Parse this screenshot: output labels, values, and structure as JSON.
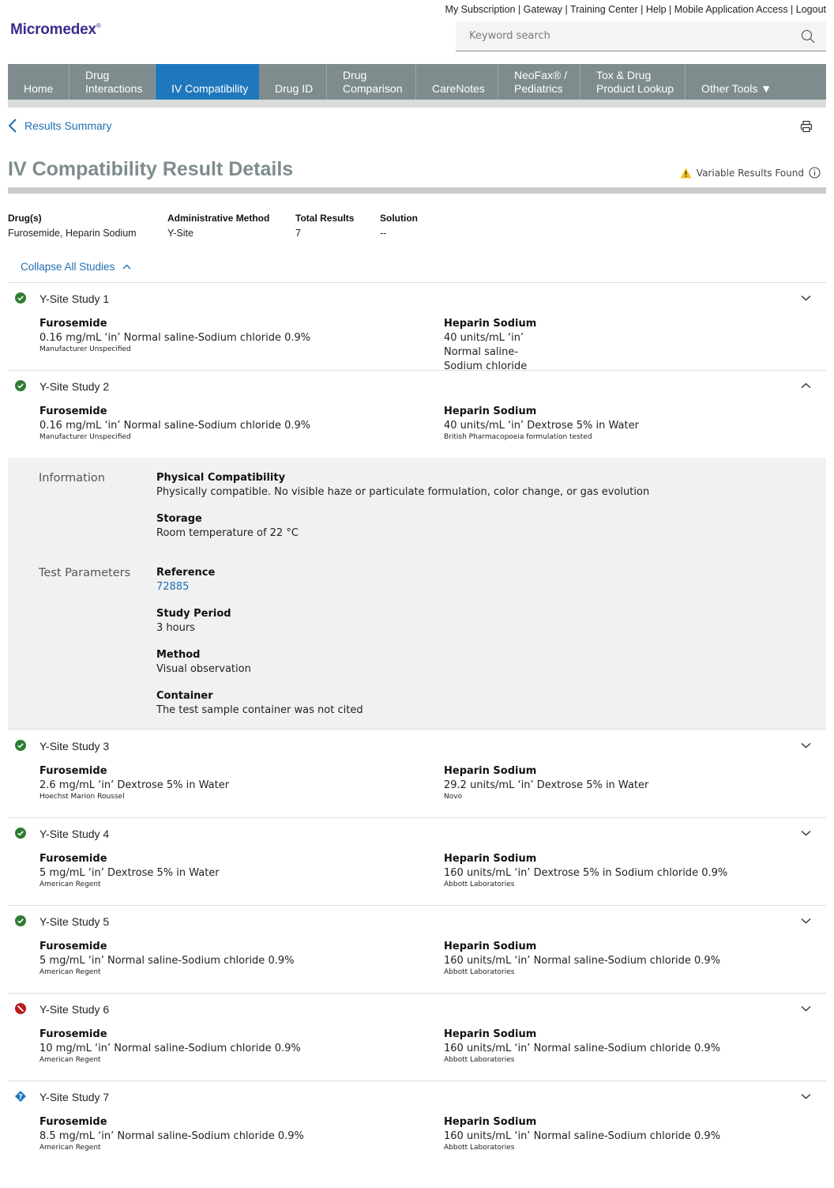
{
  "header": {
    "links": [
      "My Subscription",
      "Gateway",
      "Training Center",
      "Help",
      "Mobile Application Access",
      "Logout"
    ],
    "links_text": "My Subscription | Gateway | Training Center | Help | Mobile Application Access | Logout",
    "logo": "Micromedex",
    "logo_mark": "®",
    "search_placeholder": "Keyword search"
  },
  "nav": {
    "items": [
      {
        "label": "Home"
      },
      {
        "label": "Drug\nInteractions"
      },
      {
        "label": "IV Compatibility",
        "active": true
      },
      {
        "label": "Drug ID"
      },
      {
        "label": "Drug\nComparison"
      },
      {
        "label": "CareNotes"
      },
      {
        "label": "NeoFax® /\nPediatrics"
      },
      {
        "label": "Tox & Drug\nProduct Lookup"
      },
      {
        "label": "Other Tools ▼"
      }
    ]
  },
  "page": {
    "back_label": "Results Summary",
    "title": "IV Compatibility Result Details",
    "variable_results": "Variable Results Found",
    "collapse_label": "Collapse All Studies"
  },
  "meta": {
    "drugs_label": "Drug(s)",
    "drugs_value": "Furosemide, Heparin Sodium",
    "method_label": "Administrative Method",
    "method_value": "Y-Site",
    "total_label": "Total Results",
    "total_value": "7",
    "solution_label": "Solution",
    "solution_value": "--"
  },
  "colors": {
    "nav_bg": "#7f8c8d",
    "nav_active": "#1f78be",
    "link": "#1f6fb2",
    "compatible": "#2e7d32",
    "incompatible": "#b71c1c",
    "variable": "#1f78be",
    "warning": "#f1c21b"
  },
  "studies": [
    {
      "title": "Y-Site Study 1",
      "status": "compatible",
      "expanded": false,
      "drug1": {
        "name": "Furosemide",
        "conc": "0.16 mg/mL ‘in’ Normal saline-Sodium chloride 0.9%",
        "mfr": "Manufacturer Unspecified"
      },
      "drug2": {
        "name": "Heparin Sodium",
        "conc": "40 units/mL ‘in’",
        "conc2": "Normal saline-",
        "conc3": "Sodium chloride",
        "mfr": ""
      }
    },
    {
      "title": "Y-Site Study 2",
      "status": "compatible",
      "expanded": true,
      "drug1": {
        "name": "Furosemide",
        "conc": "0.16 mg/mL ‘in’ Normal saline-Sodium chloride 0.9%",
        "mfr": "Manufacturer Unspecified"
      },
      "drug2": {
        "name": "Heparin Sodium",
        "conc": "40 units/mL ‘in’ Dextrose 5% in Water",
        "mfr": "British Pharmacopoeia formulation tested"
      },
      "details": {
        "information_label": "Information",
        "physical_label": "Physical Compatibility",
        "physical_value": "Physically compatible. No visible haze or particulate formulation, color change, or gas evolution",
        "storage_label": "Storage",
        "storage_value": "Room temperature of 22 °C",
        "test_label": "Test Parameters",
        "reference_label": "Reference",
        "reference_value": "72885",
        "period_label": "Study Period",
        "period_value": "3 hours",
        "method_label": "Method",
        "method_value": "Visual observation",
        "container_label": "Container",
        "container_value": "The test sample container was not cited"
      }
    },
    {
      "title": "Y-Site Study 3",
      "status": "compatible",
      "expanded": false,
      "drug1": {
        "name": "Furosemide",
        "conc": "2.6 mg/mL ‘in’ Dextrose 5% in Water",
        "mfr": "Hoechst Marion Roussel"
      },
      "drug2": {
        "name": "Heparin Sodium",
        "conc": "29.2 units/mL ‘in’ Dextrose 5% in Water",
        "mfr": "Novo"
      }
    },
    {
      "title": "Y-Site Study 4",
      "status": "compatible",
      "expanded": false,
      "drug1": {
        "name": "Furosemide",
        "conc": "5 mg/mL ‘in’ Dextrose 5% in Water",
        "mfr": "American Regent"
      },
      "drug2": {
        "name": "Heparin Sodium",
        "conc": "160 units/mL ‘in’ Dextrose 5% in Sodium chloride 0.9%",
        "mfr": "Abbott Laboratories"
      }
    },
    {
      "title": "Y-Site Study 5",
      "status": "compatible",
      "expanded": false,
      "drug1": {
        "name": "Furosemide",
        "conc": "5 mg/mL ‘in’ Normal saline-Sodium chloride 0.9%",
        "mfr": "American Regent"
      },
      "drug2": {
        "name": "Heparin Sodium",
        "conc": "160 units/mL ‘in’ Normal saline-Sodium chloride 0.9%",
        "mfr": "Abbott Laboratories"
      }
    },
    {
      "title": "Y-Site Study 6",
      "status": "incompatible",
      "expanded": false,
      "drug1": {
        "name": "Furosemide",
        "conc": "10 mg/mL ‘in’ Normal saline-Sodium chloride 0.9%",
        "mfr": "American Regent"
      },
      "drug2": {
        "name": "Heparin Sodium",
        "conc": "160 units/mL ‘in’ Normal saline-Sodium chloride 0.9%",
        "mfr": "Abbott Laboratories"
      }
    },
    {
      "title": "Y-Site Study 7",
      "status": "uncertain",
      "expanded": false,
      "drug1": {
        "name": "Furosemide",
        "conc": "8.5 mg/mL ‘in’ Normal saline-Sodium chloride 0.9%",
        "mfr": "American Regent"
      },
      "drug2": {
        "name": "Heparin Sodium",
        "conc": "160 units/mL ‘in’ Normal saline-Sodium chloride 0.9%",
        "mfr": "Abbott Laboratories"
      }
    }
  ]
}
